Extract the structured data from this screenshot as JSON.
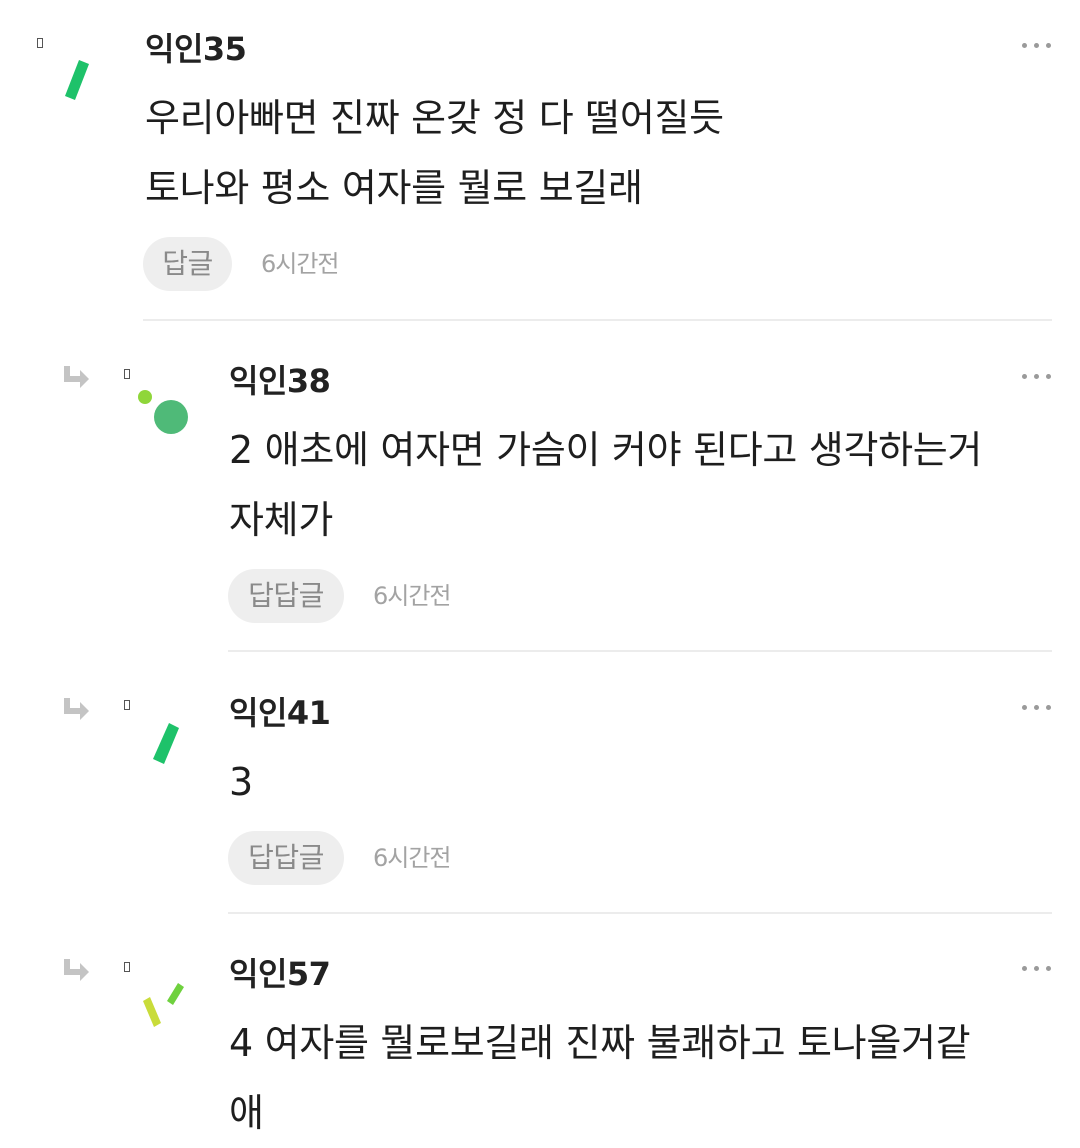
{
  "comments": [
    {
      "nickname": "익인35",
      "lines": [
        "우리아빠면 진짜 온갖 정 다 떨어질듯",
        "토나와 평소 여자를 뭘로 보길래"
      ],
      "reply_label": "답글",
      "time": "6시간전",
      "is_reply": false,
      "avatar": "green-slash-icon"
    },
    {
      "nickname": "익인38",
      "lines": [
        "2 애초에 여자면 가슴이 커야 된다고 생각하는거",
        "자체가"
      ],
      "reply_label": "답답글",
      "time": "6시간전",
      "is_reply": true,
      "avatar": "green-dots-icon"
    },
    {
      "nickname": "익인41",
      "lines": [
        "3"
      ],
      "reply_label": "답답글",
      "time": "6시간전",
      "is_reply": true,
      "avatar": "green-slash-icon"
    },
    {
      "nickname": "익인57",
      "lines": [
        "4 여자를 뭘로보길래 진짜 불쾌하고 토나올거같",
        "애"
      ],
      "reply_label": "",
      "time": "",
      "is_reply": true,
      "avatar": "yellow-green-strokes-icon"
    }
  ],
  "colors": {
    "accent_green": "#1ec26a",
    "dot_green": "#4fba78",
    "lime": "#8fd63a",
    "yellow_green": "#c9dc3a"
  }
}
